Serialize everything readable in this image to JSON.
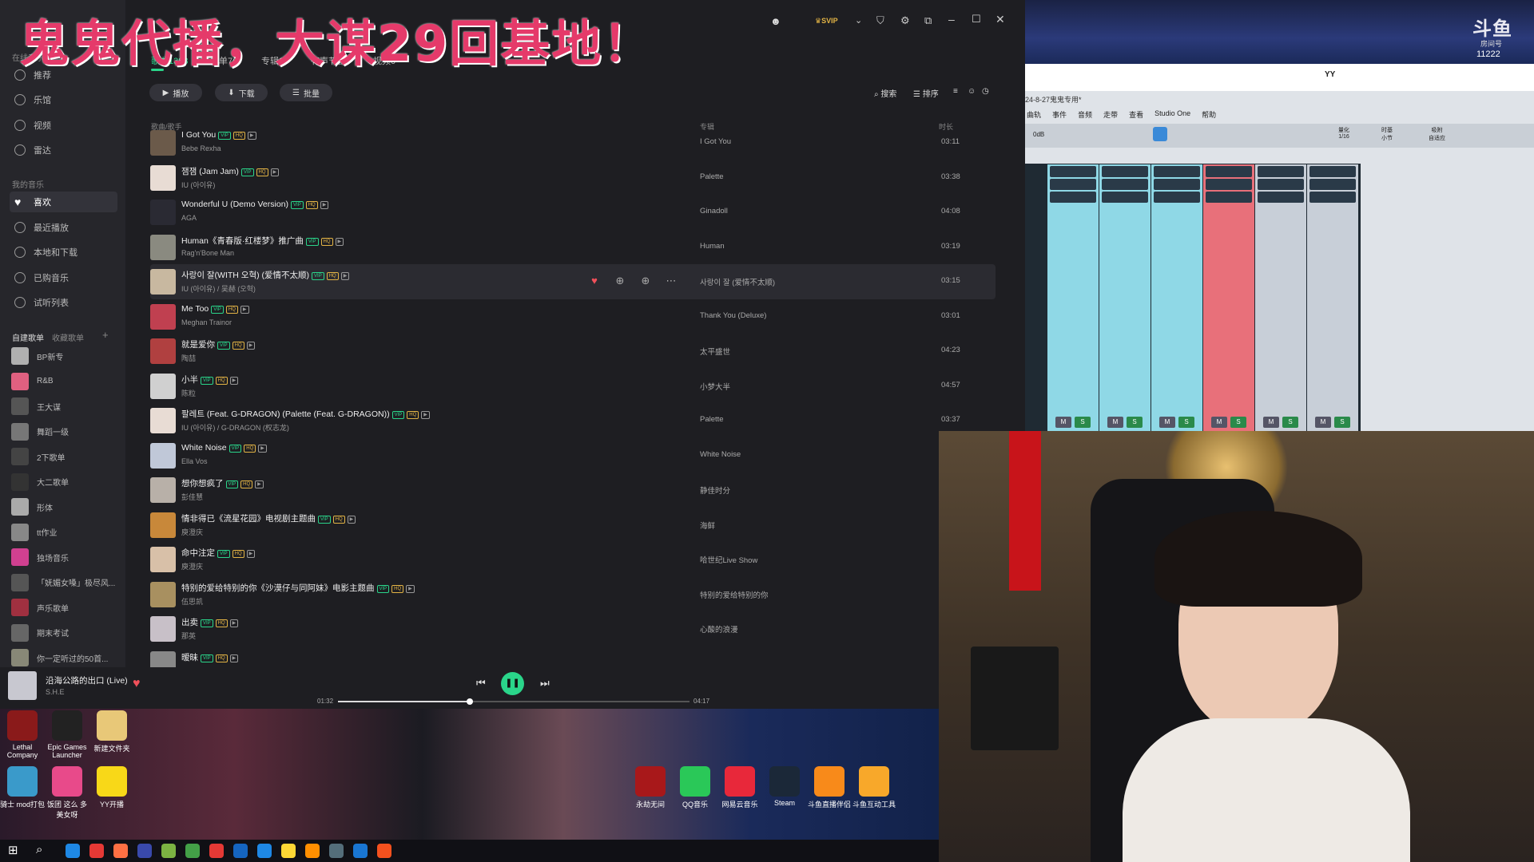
{
  "banner": {
    "text": "鬼鬼代播，大谋29回基地！"
  },
  "window": {
    "controls": [
      "minimize",
      "maximize",
      "close"
    ]
  },
  "sidebar": {
    "section_online": "在线音乐",
    "items": [
      {
        "label": "推荐",
        "icon": "home-icon"
      },
      {
        "label": "乐馆",
        "icon": "disc-icon"
      },
      {
        "label": "视频",
        "icon": "play-circle-icon"
      },
      {
        "label": "雷达",
        "icon": "radar-icon"
      }
    ],
    "section_mine": "我的音乐",
    "mine_items": [
      {
        "label": "喜欢",
        "icon": "heart-icon",
        "active": true
      },
      {
        "label": "最近播放",
        "icon": "clock-icon"
      },
      {
        "label": "本地和下载",
        "icon": "download-icon"
      },
      {
        "label": "已购音乐",
        "icon": "bag-icon"
      },
      {
        "label": "试听列表",
        "icon": "list-icon"
      }
    ],
    "playlist_tabs": [
      "自建歌单",
      "收藏歌单"
    ],
    "playlists": [
      "BP新专",
      "R&B",
      "王大谋",
      "舞蹈一级",
      "2下歌单",
      "大二歌单",
      "形体",
      "tt作业",
      "独场音乐",
      "「妩媚女嗓」极尽风...",
      "声乐歌单",
      "期末考试",
      "你一定听过的50首..."
    ]
  },
  "tabs": [
    "歌曲1388",
    "歌单76",
    "专辑14",
    "有声节目0",
    "视频0"
  ],
  "toolbar": {
    "play": "播放",
    "download": "下载",
    "batch": "批量",
    "search": "搜索",
    "sort": "排序"
  },
  "columns": {
    "title": "歌曲/歌手",
    "album": "专辑",
    "duration": "时长"
  },
  "songs": [
    {
      "title": "I Got You",
      "artist": "Bebe Rexha",
      "album": "I Got You",
      "duration": "03:11",
      "color": "#6b5a4a"
    },
    {
      "title": "잼잼 (Jam Jam)",
      "artist": "IU (아이유)",
      "album": "Palette",
      "duration": "03:38",
      "color": "#e8dcd4"
    },
    {
      "title": "Wonderful U (Demo Version)",
      "artist": "AGA",
      "album": "Ginadoll",
      "duration": "04:08",
      "color": "#2a2a33"
    },
    {
      "title": "Human《青春版·红楼梦》推广曲",
      "artist": "Rag'n'Bone Man",
      "album": "Human",
      "duration": "03:19",
      "color": "#8a8a80"
    },
    {
      "title": "사랑이 잘(WITH 오혁) (爱情不太顺)",
      "artist": "IU (아이유) / 吴赫 (오혁)",
      "album": "사랑이 잘 (爱情不太顺)",
      "duration": "03:15",
      "color": "#c8b8a0"
    },
    {
      "title": "Me Too",
      "artist": "Meghan Trainor",
      "album": "Thank You (Deluxe)",
      "duration": "03:01",
      "color": "#c04050"
    },
    {
      "title": "就是爱你",
      "artist": "陶喆",
      "album": "太平盛世",
      "duration": "04:23",
      "color": "#b04040"
    },
    {
      "title": "小半",
      "artist": "陈粒",
      "album": "小梦大半",
      "duration": "04:57",
      "color": "#d0d0d0"
    },
    {
      "title": "팔레트 (Feat. G-DRAGON) (Palette (Feat. G-DRAGON))",
      "artist": "IU (아이유) / G-DRAGON (权志龙)",
      "album": "Palette",
      "duration": "03:37",
      "color": "#e8dcd4"
    },
    {
      "title": "White Noise",
      "artist": "Ella Vos",
      "album": "White Noise",
      "duration": "",
      "color": "#c0c8d8"
    },
    {
      "title": "想你想疯了",
      "artist": "彭佳慧",
      "album": "静佳时分",
      "duration": "",
      "color": "#b8b0a8"
    },
    {
      "title": "情非得已《流星花园》电视剧主题曲",
      "artist": "庾澄庆",
      "album": "海鲜",
      "duration": "",
      "color": "#c8883a"
    },
    {
      "title": "命中注定",
      "artist": "庾澄庆",
      "album": "哈世纪Live Show",
      "duration": "",
      "color": "#d8c0a8"
    },
    {
      "title": "特别的爱给特别的你《沙漠仔与同阿妹》电影主题曲",
      "artist": "伍思凯",
      "album": "特别的爱给特别的你",
      "duration": "",
      "color": "#a89060"
    },
    {
      "title": "出卖",
      "artist": "那英",
      "album": "心酸的浪漫",
      "duration": "",
      "color": "#c8c0c8"
    },
    {
      "title": "暧昧",
      "artist": "",
      "album": "",
      "duration": "",
      "color": "#888"
    }
  ],
  "player": {
    "title": "沿海公路的出口 (Live)",
    "artist": "S.H.E",
    "elapsed": "01:32",
    "total": "04:17",
    "progress": 0.375
  },
  "desktop_icons": [
    {
      "label": "Lethal Company",
      "color": "#8a1a1a"
    },
    {
      "label": "Epic Games Launcher",
      "color": "#222"
    },
    {
      "label": "新建文件夹",
      "color": "#e8c878"
    },
    {
      "label": "骑士 mod打包",
      "color": "#3a9aca"
    },
    {
      "label": "饭团 这么 多美女呀",
      "color": "#e84a8a"
    },
    {
      "label": "YY开播",
      "color": "#f8d818"
    },
    {
      "label": "永劫无间",
      "color": "#a8181a"
    },
    {
      "label": "QQ音乐",
      "color": "#2ac858"
    },
    {
      "label": "网易云音乐",
      "color": "#e8283a"
    },
    {
      "label": "Steam",
      "color": "#1b2838"
    },
    {
      "label": "斗鱼直播伴侣",
      "color": "#f88a1a"
    },
    {
      "label": "斗鱼互动工具",
      "color": "#f8a82a"
    }
  ],
  "daw": {
    "title": "24-8-27鬼鬼专用*",
    "menu": [
      "曲轨",
      "事件",
      "音频",
      "走带",
      "查看",
      "Studio One",
      "帮助"
    ],
    "quantize_label": "量化",
    "quantize_value": "1/16",
    "timebase_label": "时基",
    "timebase_value": "小节",
    "snap_label": "吸附",
    "snap_value": "自适应",
    "level": "0dB",
    "yy_label": "YY"
  },
  "logo": {
    "name": "斗鱼",
    "room_label": "房间号",
    "room": "11222"
  }
}
